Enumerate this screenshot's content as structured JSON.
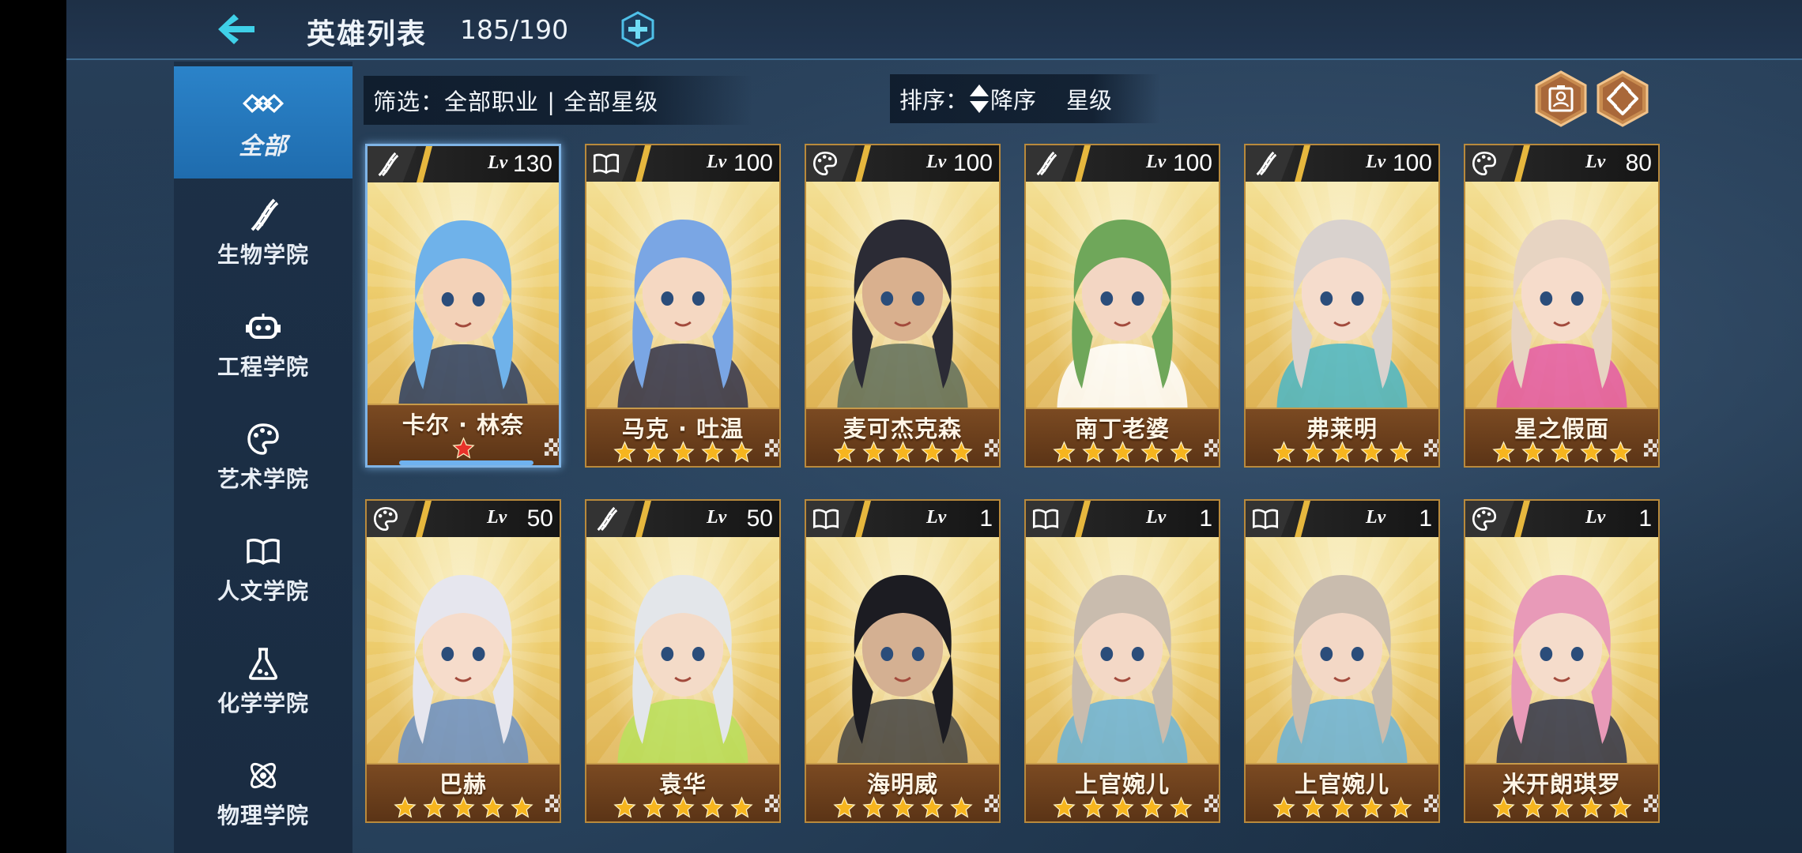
{
  "header": {
    "title": "英雄列表",
    "count": "185/190"
  },
  "sidebar": {
    "items": [
      {
        "label": "全部",
        "icon": "infinity-icon",
        "active": true
      },
      {
        "label": "生物学院",
        "icon": "dna-icon"
      },
      {
        "label": "工程学院",
        "icon": "robot-icon"
      },
      {
        "label": "艺术学院",
        "icon": "palette-icon"
      },
      {
        "label": "人文学院",
        "icon": "book-icon"
      },
      {
        "label": "化学学院",
        "icon": "flask-icon"
      },
      {
        "label": "物理学院",
        "icon": "atom-icon"
      }
    ]
  },
  "filter": {
    "text": "筛选：全部职业 | 全部星级"
  },
  "sort": {
    "label": "排序：",
    "order": "降序",
    "field": "星级"
  },
  "heroes": [
    {
      "name": "卡尔 · 林奈",
      "lv_tag": "Lv",
      "level": "130",
      "school": "dna-icon",
      "stars": 1,
      "star_color": "red",
      "special": true
    },
    {
      "name": "马克 · 吐温",
      "lv_tag": "Lv",
      "level": "100",
      "school": "book-icon",
      "stars": 5
    },
    {
      "name": "麦可杰克森",
      "lv_tag": "Lv",
      "level": "100",
      "school": "palette-icon",
      "stars": 5
    },
    {
      "name": "南丁老婆",
      "lv_tag": "Lv",
      "level": "100",
      "school": "dna-icon",
      "stars": 5
    },
    {
      "name": "弗莱明",
      "lv_tag": "Lv",
      "level": "100",
      "school": "dna-icon",
      "stars": 5
    },
    {
      "name": "星之假面",
      "lv_tag": "Lv",
      "level": "80",
      "school": "palette-icon",
      "stars": 5
    },
    {
      "name": "巴赫",
      "lv_tag": "Lv",
      "level": "50",
      "school": "palette-icon",
      "stars": 5
    },
    {
      "name": "袁华",
      "lv_tag": "Lv",
      "level": "50",
      "school": "dna-icon",
      "stars": 5
    },
    {
      "name": "海明威",
      "lv_tag": "Lv",
      "level": "1",
      "school": "book-icon",
      "stars": 5
    },
    {
      "name": "上官婉儿",
      "lv_tag": "Lv",
      "level": "1",
      "school": "book-icon",
      "stars": 5
    },
    {
      "name": "上官婉儿",
      "lv_tag": "Lv",
      "level": "1",
      "school": "book-icon",
      "stars": 5
    },
    {
      "name": "米开朗琪罗",
      "lv_tag": "Lv",
      "level": "1",
      "school": "palette-icon",
      "stars": 5
    }
  ],
  "colors": {
    "accent": "#2b83c9",
    "star": "#f6b51e",
    "card_gold": "#edcc6c",
    "name_plate": "#6b3f1c"
  }
}
